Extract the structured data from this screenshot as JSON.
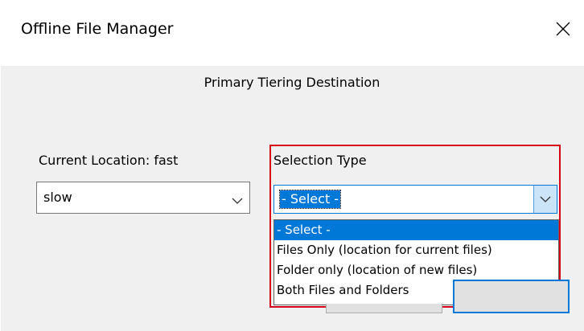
{
  "window": {
    "title": "Offline File Manager",
    "close_icon": "close-icon"
  },
  "subtitle": "Primary Tiering Destination",
  "current_location": {
    "label": "Current Location:  fast"
  },
  "destination_select": {
    "value": "slow"
  },
  "selection_type": {
    "label": "Selection Type",
    "value": "- Select -",
    "options": [
      "- Select -",
      "Files Only (location for current files)",
      "Folder only (location of new files)",
      "Both Files and Folders"
    ],
    "highlight_color": "#d9001b",
    "accent_color": "#0078d7"
  }
}
